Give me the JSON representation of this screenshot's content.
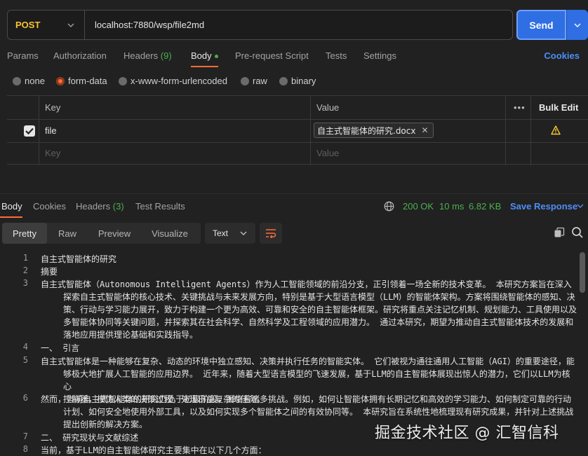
{
  "request": {
    "method": "POST",
    "url": "localhost:7880/wsp/file2md",
    "send_label": "Send"
  },
  "req_tabs": {
    "params": "Params",
    "authorization": "Authorization",
    "headers": "Headers",
    "headers_count": "(9)",
    "body": "Body",
    "prerequest": "Pre-request Script",
    "tests": "Tests",
    "settings": "Settings",
    "cookies": "Cookies"
  },
  "body_types": {
    "none": "none",
    "form_data": "form-data",
    "urlencoded": "x-www-form-urlencoded",
    "raw": "raw",
    "binary": "binary",
    "selected": "form-data"
  },
  "form_table": {
    "col_key": "Key",
    "col_value": "Value",
    "more": "•••",
    "bulk_edit": "Bulk Edit",
    "rows": [
      {
        "key": "file",
        "value": "自主式智能体的研究.docx",
        "checked": true
      }
    ],
    "placeholder_key": "Key",
    "placeholder_value": "Value"
  },
  "response": {
    "tabs": {
      "body": "Body",
      "cookies": "Cookies",
      "headers": "Headers",
      "headers_count": "(3)",
      "test_results": "Test Results"
    },
    "status": "200 OK",
    "time": "10 ms",
    "size": "6.82 KB",
    "save_label": "Save Response",
    "view_modes": {
      "pretty": "Pretty",
      "raw": "Raw",
      "preview": "Preview",
      "visualize": "Visualize"
    },
    "format": "Text",
    "lines": [
      {
        "n": "1",
        "t": "自主式智能体的研究"
      },
      {
        "n": "2",
        "t": "摘要"
      },
      {
        "n": "3",
        "t": "自主式智能体（Autonomous Intelligent Agents）作为人工智能领域的前沿分支，正引领着一场全新的技术变革。 本研究方案旨在深入",
        "c": [
          "探索自主式智能体的核心技术、关键挑战与未来发展方向，特别是基于大型语言模型（LLM）的智能体架构。方案将围绕智能体的感知、决",
          "策、行动与学习能力展开，致力于构建一个更为高效、可靠和安全的自主智能体框架。研究将重点关注记忆机制、规划能力、工具使用以及",
          "多智能体协同等关键问题，并探索其在社会科学、自然科学及工程领域的应用潜力。 通过本研究，期望为推动自主式智能体技术的发展和",
          "落地应用提供理论基础和实践指导。"
        ]
      },
      {
        "n": "4",
        "t": "一、 引言"
      },
      {
        "n": "5",
        "t": "自主式智能体是一种能够在复杂、动态的环境中独立感知、决策并执行任务的智能实体。 它们被视为通往通用人工智能（AGI）的重要途径，能",
        "c": [
          "够极大地扩展人工智能的应用边界。 近年来，随着大型语言模型的飞速发展，基于LLM的自主智能体展现出惊人的潜力，它们以LLM为核心",
          "控制器，模仿人类的决策过程，处理日益复杂的任务。"
        ]
      },
      {
        "n": "6",
        "t": "然而，当前自主式智能体的研究仍处于初级阶段，面临着诸多挑战。例如，如何让智能体拥有长期记忆和高效的学习能力、如何制定可靠的行动",
        "c": [
          "计划、如何安全地使用外部工具，以及如何实现多个智能体之间的有效协同等。 本研究旨在系统性地梳理现有研究成果，并针对上述挑战",
          "提出创新的解决方案。"
        ]
      },
      {
        "n": "7",
        "t": "二、 研究现状与文献综述"
      },
      {
        "n": "8",
        "t": "当前，基于LLM的自主智能体研究主要集中在以下几个方面："
      }
    ]
  },
  "watermark": "掘金技术社区 @ 汇智信科",
  "colors": {
    "accent": "#ff6c37",
    "method": "#f4c430",
    "send": "#2f6fe3",
    "link": "#4e8ef7",
    "status_ok": "#4caf50"
  },
  "icons": [
    "chevron-down-icon",
    "checkbox-icon",
    "warning-icon",
    "globe-icon",
    "copy-icon",
    "search-icon",
    "wrap-lines-icon",
    "close-icon"
  ]
}
